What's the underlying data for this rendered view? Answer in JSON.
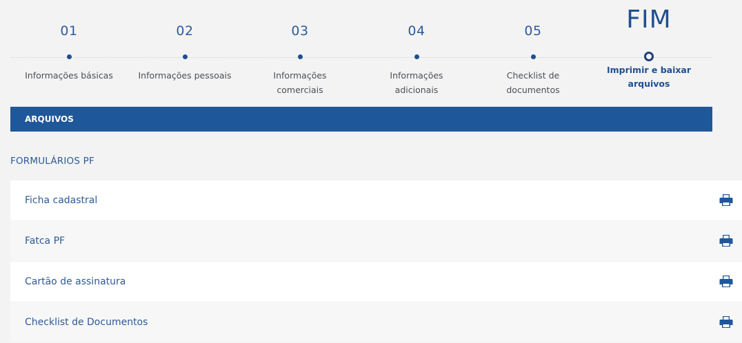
{
  "stepper": {
    "steps": [
      {
        "number": "01",
        "label_lines": [
          "Informações básicas"
        ]
      },
      {
        "number": "02",
        "label_lines": [
          "Informações pessoais"
        ]
      },
      {
        "number": "03",
        "label_lines": [
          "Informações",
          "comerciais"
        ]
      },
      {
        "number": "04",
        "label_lines": [
          "Informações",
          "adicionais"
        ]
      },
      {
        "number": "05",
        "label_lines": [
          "Checklist de",
          "documentos"
        ]
      },
      {
        "number": "FIM",
        "label_lines": [
          "Imprimir e baixar",
          "arquivos"
        ]
      }
    ]
  },
  "section": {
    "title": "ARQUIVOS",
    "group_title": "FORMULÁRIOS PF"
  },
  "files": [
    {
      "name": "Ficha cadastral",
      "icon": "print-icon"
    },
    {
      "name": "Fatca PF",
      "icon": "print-icon"
    },
    {
      "name": "Cartão de assinatura",
      "icon": "print-icon"
    },
    {
      "name": "Checklist de Documentos",
      "icon": "print-icon"
    }
  ],
  "colors": {
    "primary": "#1f579b",
    "text_blue": "#2d5a99",
    "background": "#f3f3f3"
  }
}
